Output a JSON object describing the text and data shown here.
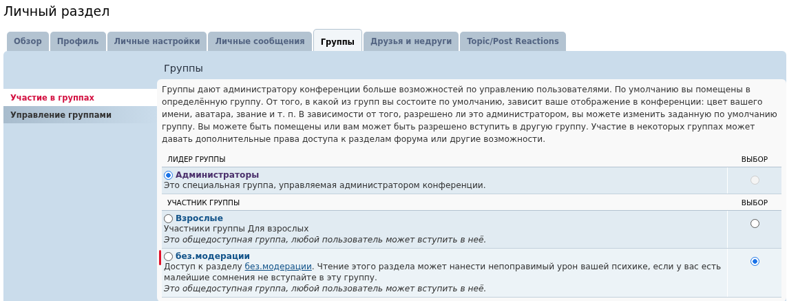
{
  "page_title": "Личный раздел",
  "tabs": [
    {
      "label": "Обзор",
      "selected": false
    },
    {
      "label": "Профиль",
      "selected": false
    },
    {
      "label": "Личные настройки",
      "selected": false
    },
    {
      "label": "Личные сообщения",
      "selected": false
    },
    {
      "label": "Группы",
      "selected": true
    },
    {
      "label": "Друзья и недруги",
      "selected": false
    },
    {
      "label": "Topic/Post Reactions",
      "selected": false
    }
  ],
  "sidebar": {
    "items": [
      {
        "label": "Участие в группах",
        "selected": true
      },
      {
        "label": "Управление группами",
        "selected": false
      }
    ]
  },
  "content": {
    "heading": "Группы",
    "intro": "Группы дают администратору конференции больше возможностей по управлению пользователями. По умолчанию вы помещены в определённую группу. От того, в какой из групп вы состоите по умолчанию, зависит ваше отображение в конференции: цвет вашего имени, аватара, звание и т. п. В зависимости от того, разрешено ли это администратором, вы можете изменить заданную по умолчанию группу. Вы можете быть помещены или вам может быть разрешено вступить в другую группу. Участие в некоторых группах может давать дополнительные права доступа к разделам форума или другие возможности.",
    "sections": [
      {
        "title": "ЛИДЕР ГРУППЫ",
        "select_label": "ВЫБОР",
        "groups": [
          {
            "name": "Администраторы",
            "default": true,
            "special": true,
            "marked": false,
            "description": [
              {
                "text": "Это специальная группа, управляемая администратором конференции."
              }
            ],
            "select_disabled": true,
            "select_checked": false
          }
        ]
      },
      {
        "title": "УЧАСТНИК ГРУППЫ",
        "select_label": "ВЫБОР",
        "groups": [
          {
            "name": "Взрослые",
            "default": false,
            "special": false,
            "marked": false,
            "description": [
              {
                "text": "Участники группы Для взрослых"
              }
            ],
            "note": "Это общедоступная группа, любой пользователь может вступить в неё.",
            "select_disabled": false,
            "select_checked": false
          },
          {
            "name": "без.модерации",
            "default": false,
            "special": false,
            "marked": true,
            "description": [
              {
                "text": "Доступ к разделу "
              },
              {
                "text": "без.модерации",
                "link": true
              },
              {
                "text": ". Чтение этого раздела может нанести непоправимый урон вашей психике, если у вас есть малейшие сомнения не вступайте в эту группу."
              }
            ],
            "note": "Это общедоступная группа, любой пользователь может вступить в неё.",
            "select_disabled": false,
            "select_checked": true
          }
        ]
      }
    ]
  }
}
